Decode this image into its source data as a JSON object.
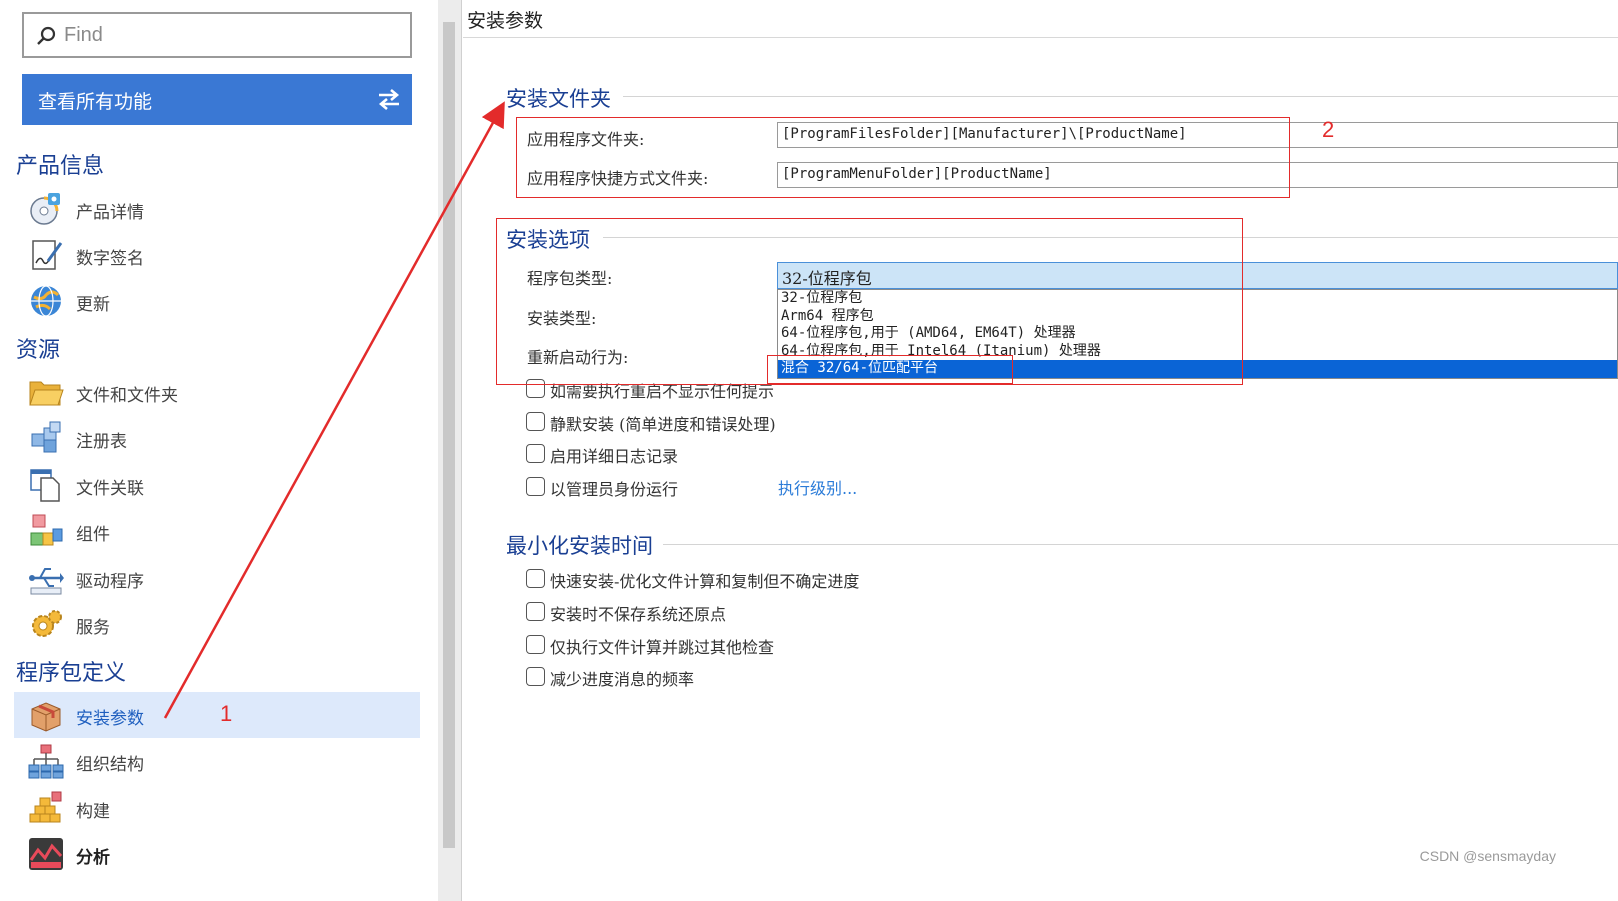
{
  "sidebar": {
    "search": {
      "placeholder": "Find"
    },
    "all_features_button": "查看所有功能",
    "sections": [
      {
        "title": "产品信息",
        "items": [
          {
            "label": "产品详情",
            "icon": "product-details-icon"
          },
          {
            "label": "数字签名",
            "icon": "signature-icon"
          },
          {
            "label": "更新",
            "icon": "update-globe-icon"
          }
        ]
      },
      {
        "title": "资源",
        "items": [
          {
            "label": "文件和文件夹",
            "icon": "folder-icon"
          },
          {
            "label": "注册表",
            "icon": "registry-cubes-icon"
          },
          {
            "label": "文件关联",
            "icon": "file-association-icon"
          },
          {
            "label": "组件",
            "icon": "components-icon"
          },
          {
            "label": "驱动程序",
            "icon": "driver-usb-icon"
          },
          {
            "label": "服务",
            "icon": "service-gear-icon"
          }
        ]
      },
      {
        "title": "程序包定义",
        "items": [
          {
            "label": "安装参数",
            "icon": "install-box-icon",
            "selected": true
          },
          {
            "label": "组织结构",
            "icon": "org-chart-icon"
          },
          {
            "label": "构建",
            "icon": "build-bricks-icon"
          },
          {
            "label": "分析",
            "icon": "analysis-chart-icon"
          }
        ]
      }
    ]
  },
  "panel": {
    "title": "安装参数",
    "install_folder": {
      "title": "安装文件夹",
      "app_folder_label": "应用程序文件夹:",
      "app_folder_value": "[ProgramFilesFolder][Manufacturer]\\[ProductName]",
      "shortcut_folder_label": "应用程序快捷方式文件夹:",
      "shortcut_folder_value": "[ProgramMenuFolder][ProductName]"
    },
    "install_options": {
      "title": "安装选项",
      "package_type_label": "程序包类型:",
      "install_type_label": "安装类型:",
      "restart_label": "重新启动行为:",
      "package_type_selected": "32-位程序包",
      "package_type_options": [
        "32-位程序包",
        "Arm64 程序包",
        "64-位程序包,用于 (AMD64, EM64T) 处理器",
        "64-位程序包,用于 Intel64 (Itanium) 处理器",
        "混合 32/64-位匹配平台"
      ],
      "highlighted_option_index": 4,
      "checkboxes": [
        {
          "label": "如需要执行重启不显示任何提示",
          "checked": false
        },
        {
          "label": "静默安装 (简单进度和错误处理)",
          "checked": false
        },
        {
          "label": "启用详细日志记录",
          "checked": false
        },
        {
          "label": "以管理员身份运行",
          "checked": false
        }
      ],
      "exec_level_link": "执行级别..."
    },
    "min_install_time": {
      "title": "最小化安装时间",
      "checkboxes": [
        {
          "label": "快速安装-优化文件计算和复制但不确定进度",
          "checked": false
        },
        {
          "label": "安装时不保存系统还原点",
          "checked": false
        },
        {
          "label": "仅执行文件计算并跳过其他检查",
          "checked": false
        },
        {
          "label": "减少进度消息的频率",
          "checked": false
        }
      ]
    }
  },
  "annotations": {
    "marker_1": "1",
    "marker_2": "2",
    "color": "#e32b2b"
  },
  "watermark": "CSDN @sensmayday",
  "colors": {
    "accent": "#3a78d4",
    "section_title": "#1a3f93",
    "selection": "#dde9fb",
    "dropdown_highlight": "#0a64d6"
  }
}
